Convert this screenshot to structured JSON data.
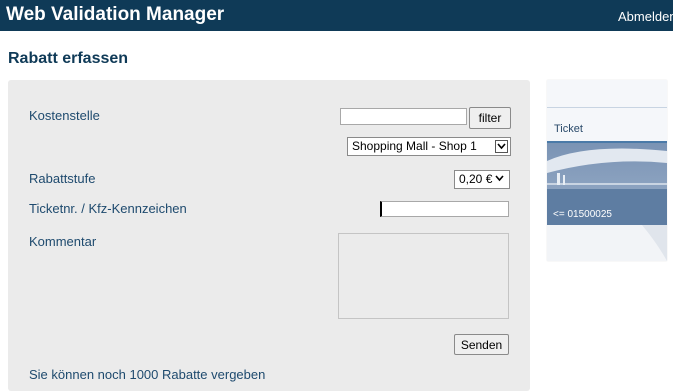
{
  "header": {
    "title": "Web Validation Manager",
    "logout_label": "Abmelden"
  },
  "page": {
    "title": "Rabatt erfassen"
  },
  "form": {
    "cost_center": {
      "label": "Kostenstelle",
      "filter_value": "",
      "filter_button": "filter",
      "selected_option": "Shopping Mall - Shop 1"
    },
    "discount_level": {
      "label": "Rabattstufe",
      "selected_option": "0,20 €"
    },
    "ticket": {
      "label": "Ticketnr. / Kfz-Kennzeichen",
      "value": ""
    },
    "comment": {
      "label": "Kommentar",
      "value": ""
    },
    "submit_label": "Senden",
    "remaining_text": "Sie können noch 1000 Rabatte vergeben"
  },
  "side_panel": {
    "ticket_label": "Ticket",
    "ticket_number": "<= 01500025"
  },
  "colors": {
    "header_bg": "#0f3a57",
    "label_text": "#1e4a6e",
    "panel_bg": "#ebebeb"
  }
}
